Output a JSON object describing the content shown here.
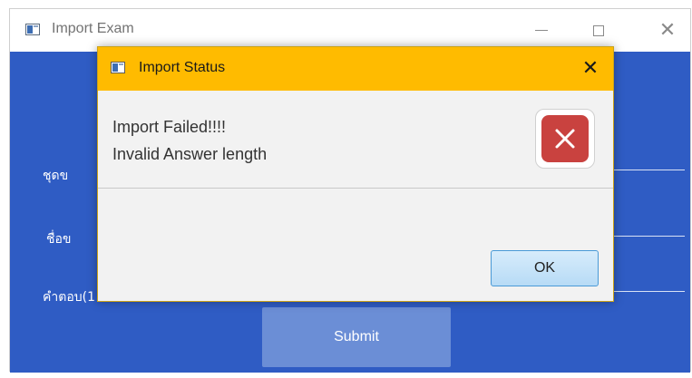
{
  "window": {
    "title": "Import Exam"
  },
  "form": {
    "labels": [
      "ชุดข",
      "ชื่อข",
      "คำตอบ(1"
    ],
    "submit_label": "Submit"
  },
  "dialog": {
    "title": "Import Status",
    "message_line1": "Import Failed!!!!",
    "message_line2": "Invalid Answer length",
    "ok_label": "OK",
    "icon": "error-icon"
  },
  "colors": {
    "app_background": "#2f5cc4",
    "dialog_titlebar": "#ffbb00",
    "error_red": "#c9423f",
    "submit_button": "#6b8ed6"
  }
}
